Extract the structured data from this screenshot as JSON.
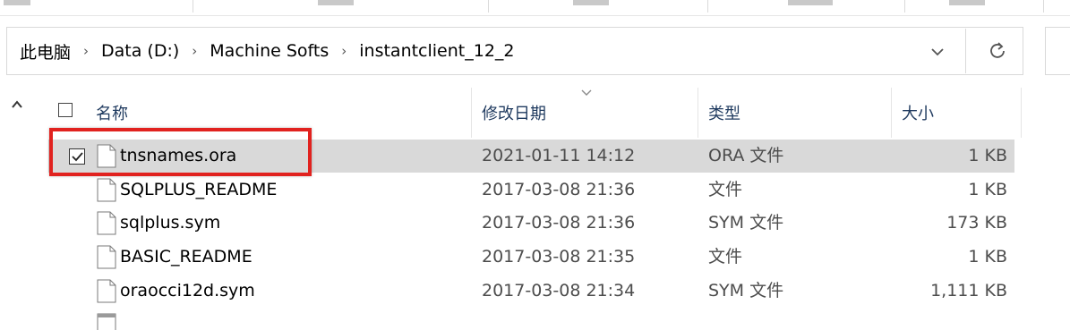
{
  "breadcrumb": {
    "items": [
      "此电脑",
      "Data (D:)",
      "Machine Softs",
      "instantclient_12_2"
    ],
    "separator": "›"
  },
  "columns": {
    "name": "名称",
    "date": "修改日期",
    "type": "类型",
    "size": "大小"
  },
  "files": [
    {
      "name": "tnsnames.ora",
      "date": "2021-01-11 14:12",
      "type": "ORA 文件",
      "size": "1 KB",
      "selected": true
    },
    {
      "name": "SQLPLUS_README",
      "date": "2017-03-08 21:36",
      "type": "文件",
      "size": "1 KB"
    },
    {
      "name": "sqlplus.sym",
      "date": "2017-03-08 21:36",
      "type": "SYM 文件",
      "size": "173 KB"
    },
    {
      "name": "BASIC_README",
      "date": "2017-03-08 21:35",
      "type": "文件",
      "size": "1 KB"
    },
    {
      "name": "oraocci12d.sym",
      "date": "2017-03-08 21:34",
      "type": "SYM 文件",
      "size": "1,111 KB"
    }
  ],
  "colors": {
    "highlight": "#e1221f",
    "selected_row": "#d9d9d9",
    "header_text": "#1f3a5f"
  },
  "icons": {
    "dropdown": "chevron-down-icon",
    "refresh": "refresh-icon",
    "scroll_up": "chevron-up-icon",
    "file": "file-icon"
  }
}
